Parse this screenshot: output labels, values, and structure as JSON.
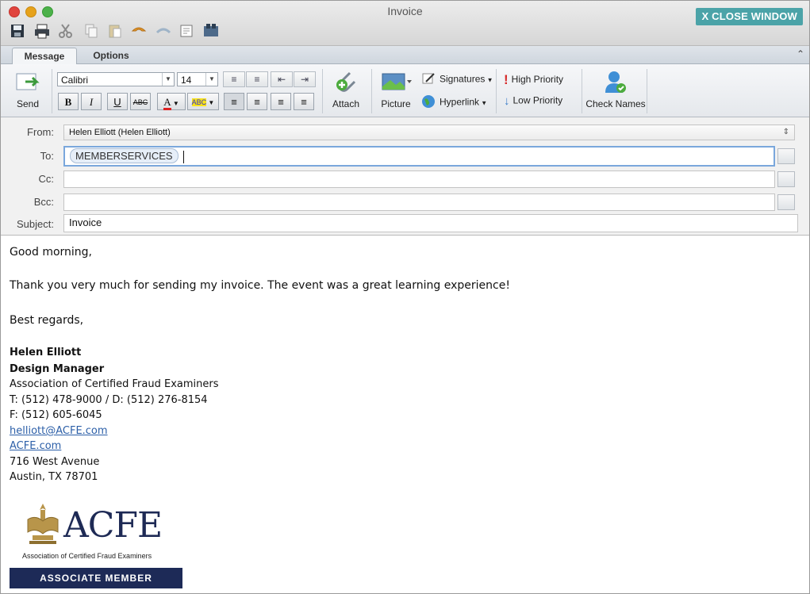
{
  "window": {
    "title": "Invoice",
    "close_button": "X CLOSE WINDOW"
  },
  "tabs": [
    {
      "label": "Message"
    },
    {
      "label": "Options"
    }
  ],
  "ribbon": {
    "send": "Send",
    "font_name": "Calibri",
    "font_size": "14",
    "attach": "Attach",
    "picture": "Picture",
    "signatures": "Signatures",
    "hyperlink": "Hyperlink",
    "high_priority": "High Priority",
    "low_priority": "Low Priority",
    "check_names": "Check Names"
  },
  "fields": {
    "from_label": "From:",
    "from_value": "Helen Elliott (Helen Elliott)",
    "to_label": "To:",
    "to_recipient": "MEMBERSERVICES",
    "cc_label": "Cc:",
    "bcc_label": "Bcc:",
    "subject_label": "Subject:",
    "subject_value": "Invoice"
  },
  "message": {
    "greeting": "Good morning,",
    "line1": "Thank you very much for sending my invoice. The event was a great learning experience!",
    "closing": "Best regards,",
    "signature": {
      "name": "Helen Elliott",
      "title": "Design Manager",
      "org": "Association of Certified Fraud Examiners",
      "phone": "T: (512) 478-9000 / D: (512) 276-8154",
      "fax": "F: (512) 605-6045",
      "email": "helliott@ACFE.com",
      "website": "ACFE.com",
      "address1": "716 West Avenue",
      "address2": "Austin, TX 78701"
    },
    "logo": {
      "text": "ACFE",
      "tagline": "Association of Certified Fraud Examiners",
      "badge": "ASSOCIATE MEMBER"
    }
  },
  "colors": {
    "accent": "#4ba3a8",
    "link": "#2c5fa8",
    "badge": "#1d2a57"
  }
}
